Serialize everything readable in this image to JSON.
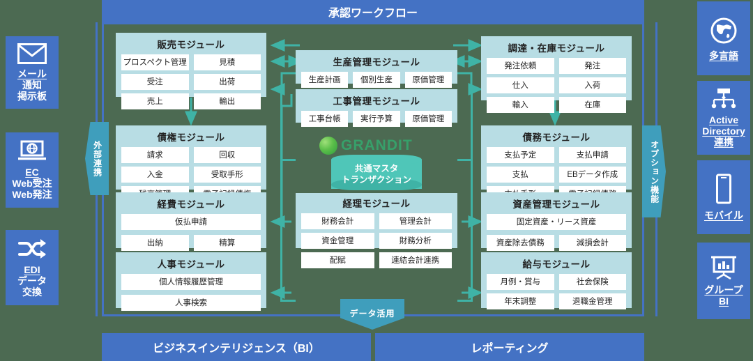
{
  "header": {
    "title": "承認ワークフロー"
  },
  "footer": {
    "left": "ビジネスインテリジェンス（BI）",
    "right": "レポーティング",
    "data_chevron": "データ活用"
  },
  "chevrons": {
    "left": "外部連携",
    "right": "オプション機能"
  },
  "colors": {
    "brand_blue": "#4472c4",
    "module_bg": "#b8dde4",
    "teal": "#3fb3a6",
    "chevron": "#3f9ebc",
    "backdrop": "#4c6a52",
    "logo_green": "#37a06a"
  },
  "logo": {
    "text": "GRANDIT",
    "icon": "globe-icon"
  },
  "master": {
    "line1": "共通マスタ",
    "line2": "トランザクション"
  },
  "left_tiles": [
    {
      "icon": "mail-icon",
      "lines": [
        "メール",
        "通知",
        "掲示板"
      ],
      "underline": 0
    },
    {
      "icon": "laptop-globe-icon",
      "lines": [
        "EC",
        "Web受注",
        "Web発注"
      ],
      "underline": 1
    },
    {
      "icon": "shuffle-icon",
      "lines": [
        "EDI",
        "データ",
        "交換"
      ],
      "underline": 1
    }
  ],
  "right_tiles": [
    {
      "icon": "globe-world-icon",
      "lines": [
        "多言語"
      ],
      "underline": 1
    },
    {
      "icon": "org-chart-icon",
      "lines": [
        "Active",
        "Directory",
        "連携"
      ],
      "underline": 3
    },
    {
      "icon": "mobile-icon",
      "lines": [
        "モバイル"
      ],
      "underline": 1
    },
    {
      "icon": "presentation-chart-icon",
      "lines": [
        "グループ",
        "BI"
      ],
      "underline": 2
    }
  ],
  "modules": [
    {
      "id": "sales",
      "title": "販売モジュール",
      "rows": [
        [
          "プロスペクト管理",
          "見積"
        ],
        [
          "受注",
          "出荷"
        ],
        [
          "売上",
          "輸出"
        ]
      ]
    },
    {
      "id": "receivables",
      "title": "債権モジュール",
      "rows": [
        [
          "請求",
          "回収"
        ],
        [
          "入金",
          "受取手形"
        ],
        [
          "残高管理",
          "電子記録債権"
        ]
      ]
    },
    {
      "id": "expense",
      "title": "経費モジュール",
      "rows": [
        [
          "仮払申請"
        ],
        [
          "出納",
          "精算"
        ]
      ]
    },
    {
      "id": "hr",
      "title": "人事モジュール",
      "rows": [
        [
          "個人情報履歴管理"
        ],
        [
          "人事検索"
        ]
      ]
    },
    {
      "id": "production",
      "title": "生産管理モジュール",
      "rows": [
        [
          "生産計画",
          "個別生産",
          "原価管理"
        ]
      ]
    },
    {
      "id": "construction",
      "title": "工事管理モジュール",
      "rows": [
        [
          "工事台帳",
          "実行予算",
          "原価管理"
        ]
      ]
    },
    {
      "id": "accounting",
      "title": "経理モジュール",
      "rows": [
        [
          "財務会計",
          "管理会計"
        ],
        [
          "資金管理",
          "財務分析"
        ],
        [
          "配賦",
          "連結会計連携"
        ]
      ]
    },
    {
      "id": "procurement",
      "title": "調達・在庫モジュール",
      "rows": [
        [
          "発注依頼",
          "発注"
        ],
        [
          "仕入",
          "入荷"
        ],
        [
          "輸入",
          "在庫"
        ]
      ]
    },
    {
      "id": "payables",
      "title": "債務モジュール",
      "rows": [
        [
          "支払予定",
          "支払申請"
        ],
        [
          "支払",
          "EBデータ作成"
        ],
        [
          "支払手形",
          "電子記録債務"
        ]
      ]
    },
    {
      "id": "asset",
      "title": "資産管理モジュール",
      "rows": [
        [
          "固定資産・リース資産"
        ],
        [
          "資産除去債務",
          "減損会計"
        ]
      ]
    },
    {
      "id": "payroll",
      "title": "給与モジュール",
      "rows": [
        [
          "月例・賞与",
          "社会保険"
        ],
        [
          "年末調整",
          "退職金管理"
        ]
      ]
    }
  ]
}
